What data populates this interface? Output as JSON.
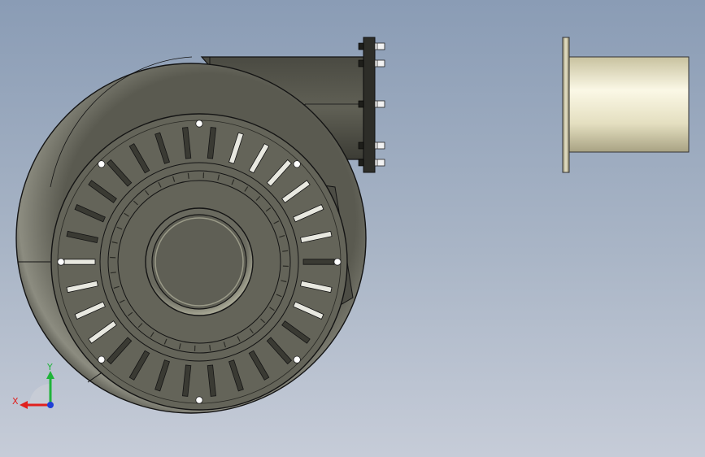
{
  "triad": {
    "x_label": "X",
    "y_label": "Y",
    "x_color": "#e0201e",
    "y_color": "#1fb33a",
    "z_color": "#1f3fd6"
  },
  "colors": {
    "housing_dark": "#3f3f38",
    "housing_mid": "#5f5f55",
    "housing_light": "#8d8d80",
    "outline": "#141414",
    "pipe_light": "#f6f2da",
    "pipe_shade": "#b8b291",
    "slot_highlight": "#e8e8e0"
  },
  "icons": [
    "bolt-icon",
    "mounting-hole-icon",
    "axis-triad-icon"
  ]
}
